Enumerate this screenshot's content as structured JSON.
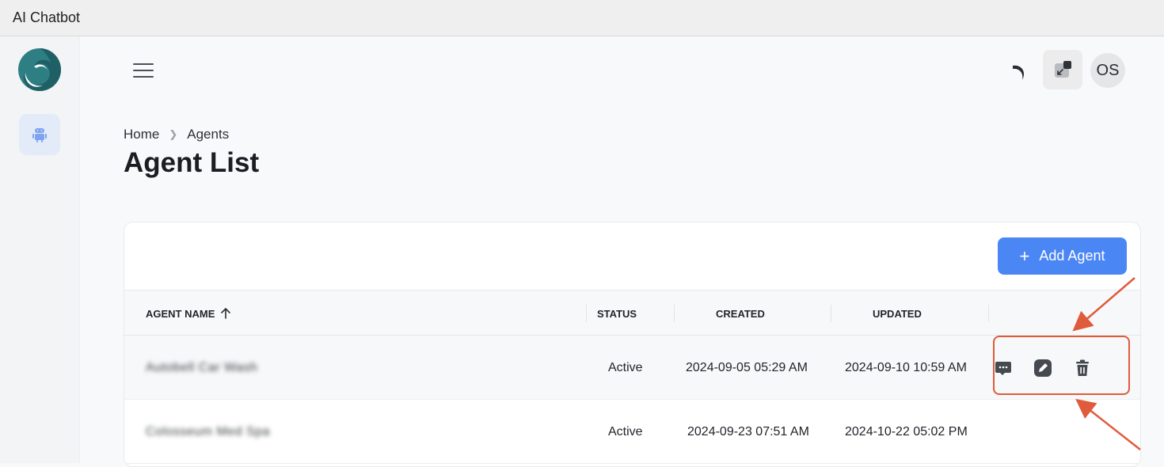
{
  "app": {
    "title": "AI Chatbot"
  },
  "header": {
    "avatar_initials": "OS",
    "icons": [
      "menu-icon",
      "theme-toggle-icon",
      "collapse-window-icon"
    ]
  },
  "sidebar": {
    "items": [
      {
        "name": "agents",
        "icon": "android-robot-icon",
        "active": true
      }
    ]
  },
  "breadcrumb": {
    "home": "Home",
    "current": "Agents"
  },
  "page": {
    "title": "Agent List"
  },
  "toolbar": {
    "add_label": "Add Agent"
  },
  "table": {
    "columns": {
      "name": "AGENT NAME",
      "status": "STATUS",
      "created": "CREATED",
      "updated": "UPDATED"
    },
    "sort": {
      "column": "name",
      "direction": "ascending"
    },
    "rows": [
      {
        "name": "Autobell Car Wash",
        "status": "Active",
        "created": "2024-09-05 05:29 AM",
        "updated": "2024-09-10 10:59 AM"
      },
      {
        "name": "Colosseum Med Spa",
        "status": "Active",
        "created": "2024-09-23 07:51 AM",
        "updated": "2024-10-22 05:02 PM"
      }
    ],
    "row_actions": [
      "chat-icon",
      "edit-icon",
      "delete-icon"
    ]
  },
  "colors": {
    "primary": "#4b86f5",
    "highlight": "#e05a3c",
    "sidebar_active": "#e3eaf8"
  }
}
